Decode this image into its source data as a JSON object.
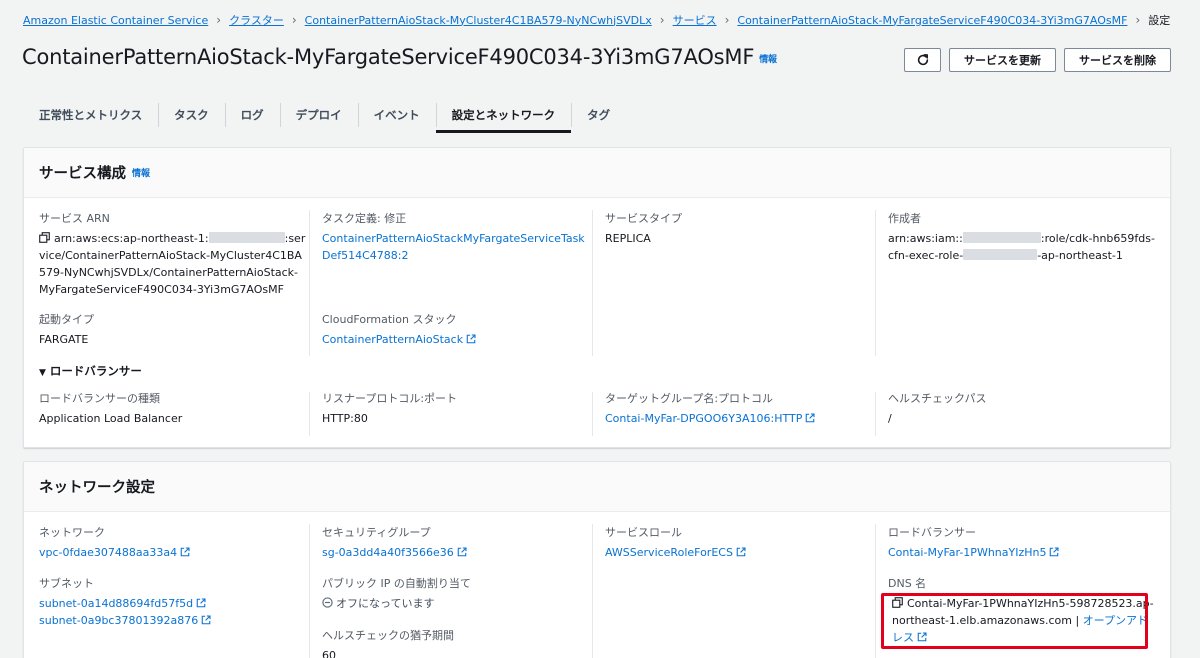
{
  "breadcrumb": {
    "items": [
      "Amazon Elastic Container Service",
      "クラスター",
      "ContainerPatternAioStack-MyCluster4C1BA579-NyNCwhjSVDLx",
      "サービス",
      "ContainerPatternAioStack-MyFargateServiceF490C034-3Yi3mG7AOsMF"
    ],
    "current": "設定"
  },
  "header": {
    "title": "ContainerPatternAioStack-MyFargateServiceF490C034-3Yi3mG7AOsMF",
    "info": "情報",
    "refresh_icon": "refresh-icon",
    "update_label": "サービスを更新",
    "delete_label": "サービスを削除"
  },
  "tabs": [
    {
      "label": "正常性とメトリクス",
      "active": false
    },
    {
      "label": "タスク",
      "active": false
    },
    {
      "label": "ログ",
      "active": false
    },
    {
      "label": "デプロイ",
      "active": false
    },
    {
      "label": "イベント",
      "active": false
    },
    {
      "label": "設定とネットワーク",
      "active": true
    },
    {
      "label": "タグ",
      "active": false
    }
  ],
  "service_config": {
    "title": "サービス構成",
    "info": "情報",
    "arn_label": "サービス ARN",
    "arn_prefix": "arn:aws:ecs:ap-northeast-1:",
    "arn_suffix": ":service/ContainerPatternAioStack-MyCluster4C1BA579-NyNCwhjSVDLx/ContainerPatternAioStack-MyFargateServiceF490C034-3Yi3mG7AOsMF",
    "task_def_label": "タスク定義: 修正",
    "task_def_value": "ContainerPatternAioStackMyFargateServiceTaskDef514C4788:2",
    "service_type_label": "サービスタイプ",
    "service_type_value": "REPLICA",
    "created_by_label": "作成者",
    "created_by_prefix": "arn:aws:iam::",
    "created_by_mid": ":role/cdk-hnb659fds-cfn-exec-role-",
    "created_by_suffix": "-ap-northeast-1",
    "launch_type_label": "起動タイプ",
    "launch_type_value": "FARGATE",
    "cfn_stack_label": "CloudFormation スタック",
    "cfn_stack_value": "ContainerPatternAioStack",
    "lb_section": "ロードバランサー",
    "lb_type_label": "ロードバランサーの種類",
    "lb_type_value": "Application Load Balancer",
    "listener_label": "リスナープロトコル:ポート",
    "listener_value": "HTTP:80",
    "tg_label": "ターゲットグループ名:プロトコル",
    "tg_value": "Contai-MyFar-DPGOO6Y3A106:HTTP",
    "health_path_label": "ヘルスチェックパス",
    "health_path_value": "/"
  },
  "network": {
    "title": "ネットワーク設定",
    "network_label": "ネットワーク",
    "network_value": "vpc-0fdae307488aa33a4",
    "sg_label": "セキュリティグループ",
    "sg_value": "sg-0a3dd4a40f3566e36",
    "service_role_label": "サービスロール",
    "service_role_value": "AWSServiceRoleForECS",
    "lb_label": "ロードバランサー",
    "lb_value": "Contai-MyFar-1PWhnaYIzHn5",
    "subnet_label": "サブネット",
    "subnets": [
      "subnet-0a14d88694fd57f5d",
      "subnet-0a9bc37801392a876"
    ],
    "public_ip_label": "パブリック IP の自動割り当て",
    "public_ip_value": "オフになっています",
    "dns_label": "DNS 名",
    "dns_value": "Contai-MyFar-1PWhnaYIzHn5-598728523.ap-northeast-1.elb.amazonaws.com",
    "dns_separator": "|",
    "open_address": "オープンアドレス",
    "grace_label": "ヘルスチェックの猶予期間",
    "grace_value": "60"
  },
  "colors": {
    "link": "#0972d3",
    "highlight": "#e3001b",
    "active_tab": "#16191f"
  }
}
